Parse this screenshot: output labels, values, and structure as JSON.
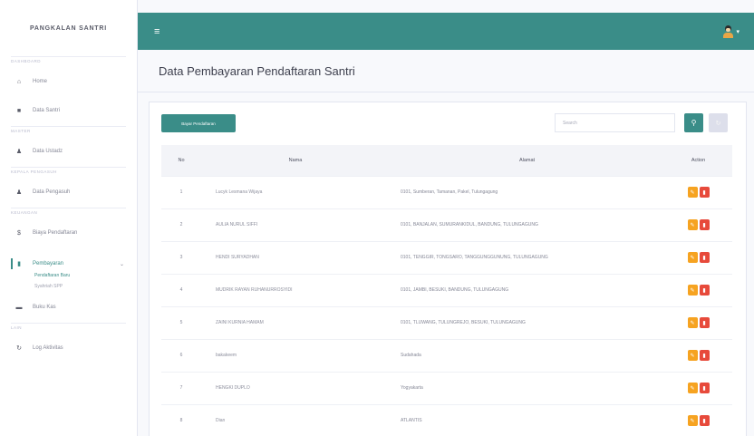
{
  "brand": "PANGKALAN SANTRI",
  "sidebar": {
    "items": [
      {
        "heading": "DASHBOARD",
        "label": "Home",
        "icon": "home-icon",
        "glyph": "⌂"
      },
      {
        "heading": "",
        "label": "Data Santri",
        "icon": "user-icon",
        "glyph": "■"
      },
      {
        "heading": "MASTER",
        "label": "Data Ustadz",
        "icon": "users-icon",
        "glyph": "♟"
      },
      {
        "heading": "KEPALA PENGASUH",
        "label": "Data Pengasuh",
        "icon": "user-tie-icon",
        "glyph": "♟"
      },
      {
        "heading": "KEUANGAN",
        "label": "Biaya Pendaftaran",
        "icon": "money-icon",
        "glyph": "$"
      },
      {
        "heading": "",
        "label": "Pembayaran",
        "icon": "wallet-icon",
        "glyph": "▮"
      },
      {
        "heading": "",
        "label": "Buku Kas",
        "icon": "book-icon",
        "glyph": "▬"
      },
      {
        "heading": "LAIN",
        "label": "Log Aktivitas",
        "icon": "history-icon",
        "glyph": "↻"
      }
    ],
    "submenu": [
      "Pendaftaran Baru",
      "Syahriah SPP"
    ]
  },
  "page_title": "Data Pembayaran Pendaftaran Santri",
  "toolbar": {
    "add_label": "Bayar Pendaftaran",
    "search_placeholder": "Search"
  },
  "table": {
    "headers": [
      "No",
      "Nama",
      "Alamat",
      "Action"
    ],
    "rows": [
      {
        "no": "1",
        "name": "Lucyk Lesmana Wijaya",
        "address": "0101, Sumberan, Tamanan, Pakel, Tulungagung"
      },
      {
        "no": "2",
        "name": "AULIA NURUL SIFFI",
        "address": "0101, BANJALAN, SUMURANKIDUL, BANDUNG, TULUNGAGUNG"
      },
      {
        "no": "3",
        "name": "HENDI SURYADHAN",
        "address": "0101, TENGGIR, TONGSARO, TANGGUNGGUNUNG, TULUNGAGUNG"
      },
      {
        "no": "4",
        "name": "MUDRIK RAYAN RUHANURROSYIDI",
        "address": "0101, JAMBI, BESUKI, BANDUNG, TULUNGAGUNG"
      },
      {
        "no": "5",
        "name": "ZAINI KURNIA HAMAM",
        "address": "0101, TLUWANG, TULUNGREJO, BESUKI, TULUNGAGUNG"
      },
      {
        "no": "6",
        "name": "bakakeem",
        "address": "Sudahada"
      },
      {
        "no": "7",
        "name": "HENGKI DUPLO",
        "address": "Yogyakarta"
      },
      {
        "no": "8",
        "name": "Dian",
        "address": "ATLANTIS"
      }
    ]
  },
  "colors": {
    "primary": "#3a8d88",
    "edit": "#f6a321",
    "delete": "#e74a3b"
  }
}
